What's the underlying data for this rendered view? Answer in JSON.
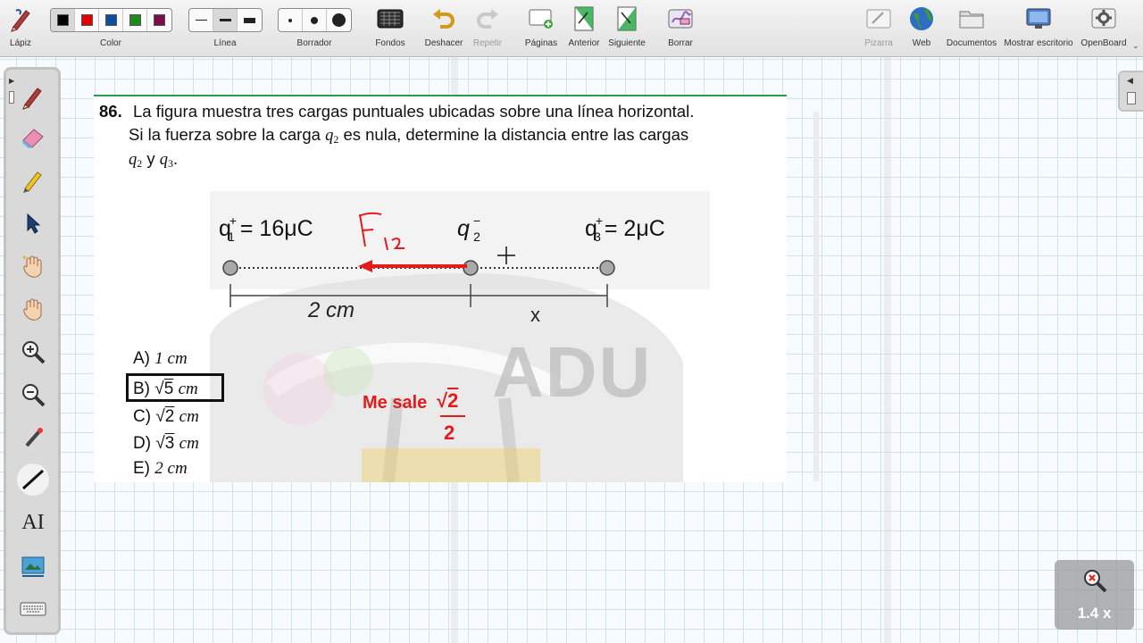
{
  "toolbar": {
    "pencil_label": "Lápiz",
    "color_label": "Color",
    "colors": [
      "#000000",
      "#e00000",
      "#0b4f9c",
      "#1e8a1e",
      "#7a0f4a"
    ],
    "line_label": "Línea",
    "eraser_label": "Borrador",
    "backgrounds_label": "Fondos",
    "undo_label": "Deshacer",
    "redo_label": "Repetir",
    "pages_label": "Páginas",
    "previous_label": "Anterior",
    "next_label": "Siguiente",
    "clear_label": "Borrar",
    "board_label": "Pizarra",
    "web_label": "Web",
    "documents_label": "Documentos",
    "desktop_label": "Mostrar escritorio",
    "openboard_label": "OpenBoard"
  },
  "question": {
    "number": "86.",
    "line1": "La figura muestra tres cargas puntuales ubicadas sobre una línea horizontal.",
    "line2_a": "Si la fuerza sobre la carga ",
    "q2": "q",
    "q2_sub": "2",
    "line2_b": " es nula, determine la distancia entre las cargas",
    "line3_q": "q",
    "line3_q_sub": "2",
    "line3_y": " y ",
    "line3_q3": "q",
    "line3_q3_sub": "3",
    "line3_end": "."
  },
  "figure": {
    "q1_label": "q",
    "q1_sign": "+",
    "q1_sub": "1",
    "q1_value": "= 16μC",
    "q2_label": "q",
    "q2_sign": "−",
    "q2_sub": "2",
    "q3_label": "q",
    "q3_sign": "+",
    "q3_sub": "3",
    "q3_value": "= 2μC",
    "distance_left": "2 cm",
    "distance_right": "x",
    "force_label": "F",
    "force_sub": "12",
    "watermark": "ADU"
  },
  "options": [
    {
      "letter": "A)",
      "value": "1 cm"
    },
    {
      "letter": "B)",
      "radical": "5",
      "unit": "cm",
      "selected": true
    },
    {
      "letter": "C)",
      "radical": "2",
      "unit": "cm"
    },
    {
      "letter": "D)",
      "radical": "3",
      "unit": "cm"
    },
    {
      "letter": "E)",
      "value": "2 cm"
    }
  ],
  "annotation": {
    "text": "Me sale",
    "radical": "2",
    "denominator": "2"
  },
  "zoom": {
    "level": "1.4 x"
  },
  "colors": {
    "ink_red": "#e31b1b",
    "rule_green": "#2f9a4b",
    "toolbar_bg": "#e8e8e8"
  }
}
